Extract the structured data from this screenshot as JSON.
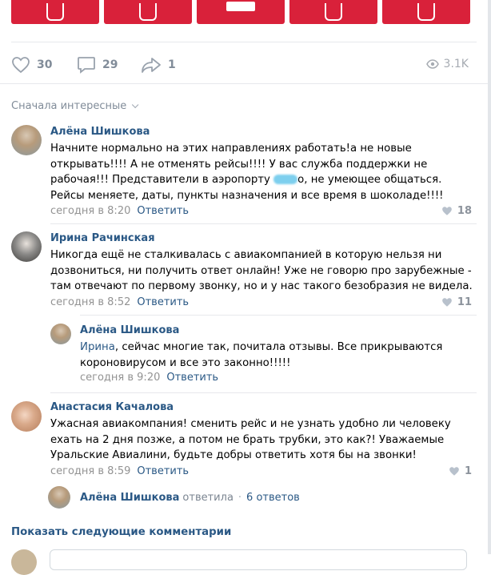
{
  "actions": {
    "likes_count": "30",
    "comments_count": "29",
    "shares_count": "1",
    "views_count": "3.1K"
  },
  "sort": {
    "label": "Сначала интересные"
  },
  "comments": [
    {
      "author": "Алёна Шишкова",
      "text_before_blur": "Начните нормально на этих направлениях работать!а не новые открывать!!!! А не отменять рейсы!!!! У вас служба поддержки не рабочая!!! Представители в аэропорту ",
      "text_after_blur": "о, не умеющее общаться. Рейсы меняете, даты, пункты назначения и все время в шоколаде!!!!",
      "time": "сегодня в 8:20",
      "reply_label": "Ответить",
      "likes": "18"
    },
    {
      "author": "Ирина Рачинская",
      "text": "Никогда ещё не сталкивалась с авиакомпанией в которую нельзя ни дозвониться, ни получить ответ онлайн! Уже не говорю про зарубежные - там отвечают по первому звонку, но и у нас такого безобразия не видела.",
      "time": "сегодня в 8:52",
      "reply_label": "Ответить",
      "likes": "11"
    },
    {
      "author": "Алёна Шишкова",
      "addressee": "Ирина",
      "text": ", сейчас многие так, почитала отзывы. Все прикрываются короновирусом и все это законно!!!!!",
      "time": "сегодня в 9:20",
      "reply_label": "Ответить"
    },
    {
      "author": "Анастасия Качалова",
      "text": "Ужасная авиакомпания! сменить рейс и не узнать удобно ли человеку ехать на 2 дня позже, а потом не брать трубки, это как?! Уважаемые Уральские Авиалини, будьте добры ответить хотя бы на звонки!",
      "time": "сегодня в 8:59",
      "reply_label": "Ответить",
      "likes": "1"
    }
  ],
  "thread": {
    "author": "Алёна Шишкова",
    "replied_word": "ответила",
    "dot": "·",
    "count": "6 ответов"
  },
  "show_more": "Показать следующие комментарии",
  "colors": {
    "link": "#2a5885",
    "tile_red": "#d9213a",
    "meta_gray": "#939393"
  }
}
